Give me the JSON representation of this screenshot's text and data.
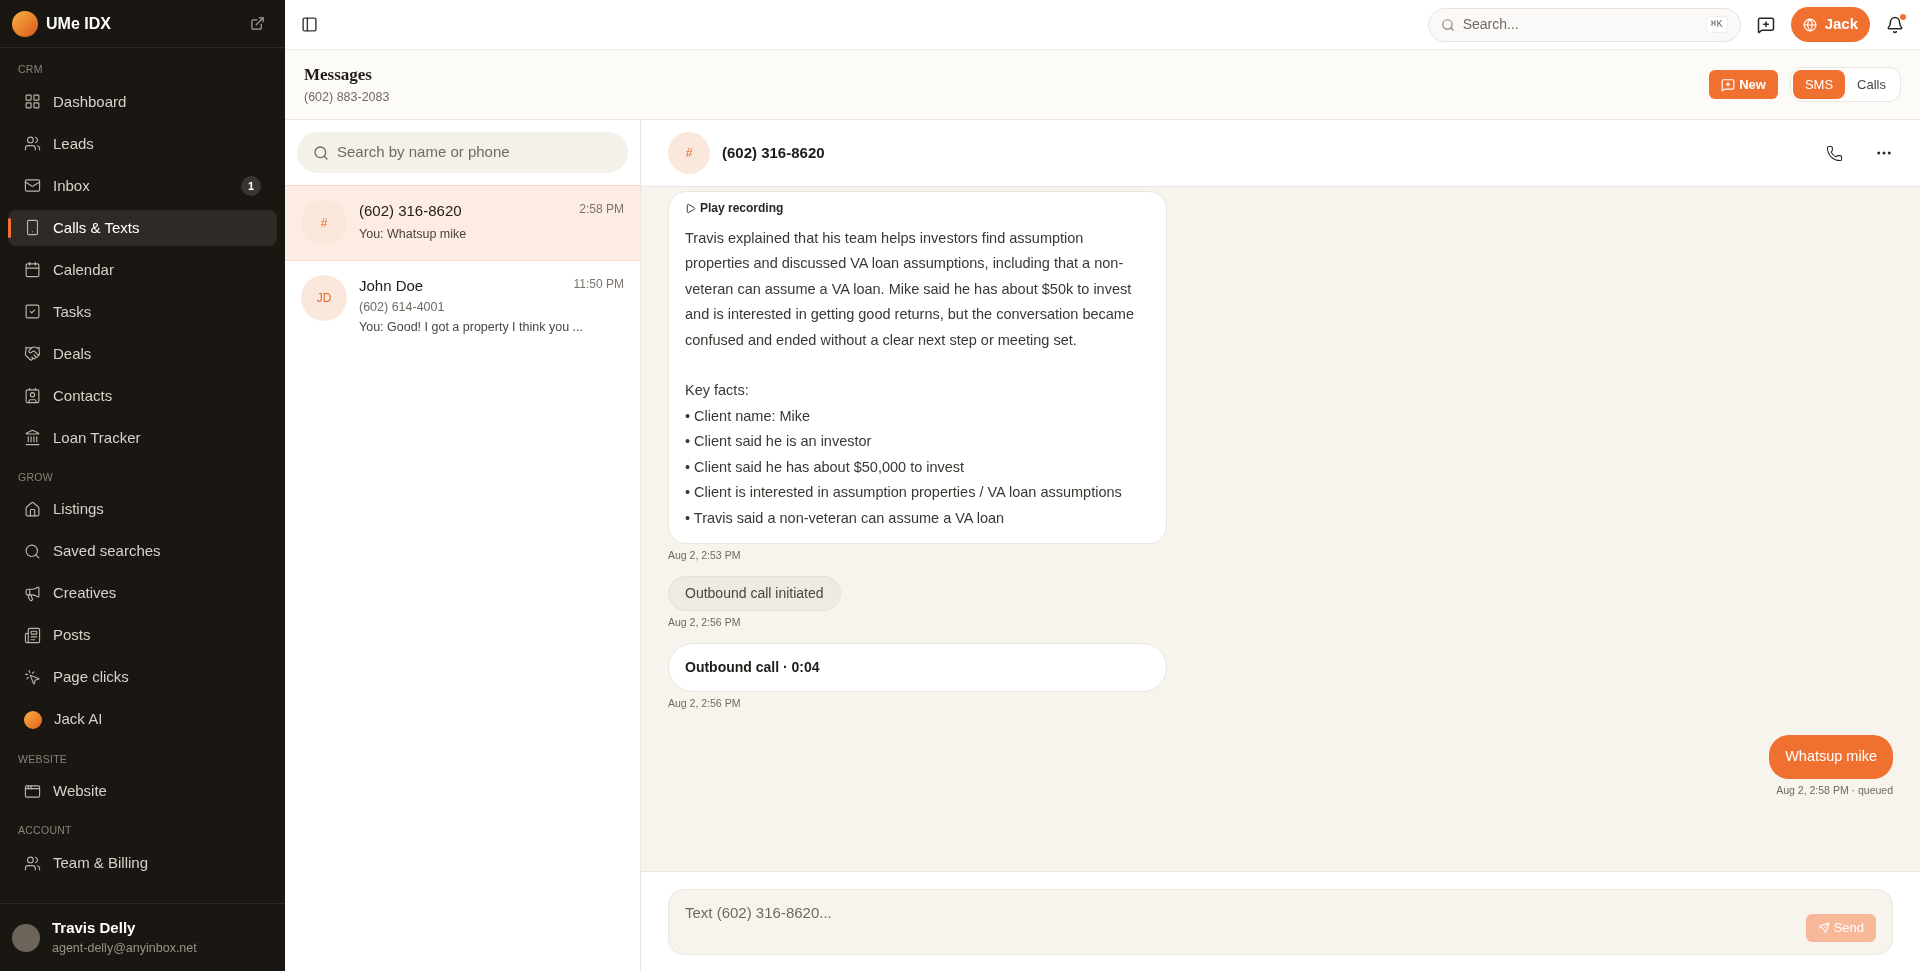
{
  "brand": {
    "name": "UMe IDX"
  },
  "sidebar": {
    "sections": [
      {
        "title": "CRM",
        "items": [
          {
            "label": "Dashboard",
            "kind": "nav",
            "selected": false
          },
          {
            "label": "Leads",
            "kind": "nav",
            "selected": false
          },
          {
            "label": "Inbox",
            "kind": "nav",
            "selected": false,
            "badge": "1"
          },
          {
            "label": "Calls & Texts",
            "kind": "nav",
            "selected": true
          },
          {
            "label": "Calendar",
            "kind": "nav",
            "selected": false
          },
          {
            "label": "Tasks",
            "kind": "nav",
            "selected": false
          },
          {
            "label": "Deals",
            "kind": "nav",
            "selected": false
          },
          {
            "label": "Contacts",
            "kind": "nav",
            "selected": false
          },
          {
            "label": "Loan Tracker",
            "kind": "nav",
            "selected": false
          }
        ]
      },
      {
        "title": "GROW",
        "items": [
          {
            "label": "Listings",
            "kind": "nav",
            "selected": false
          },
          {
            "label": "Saved searches",
            "kind": "nav",
            "selected": false
          },
          {
            "label": "Creatives",
            "kind": "nav",
            "selected": false
          },
          {
            "label": "Posts",
            "kind": "nav",
            "selected": false
          },
          {
            "label": "Page clicks",
            "kind": "nav",
            "selected": false
          },
          {
            "label": "Jack AI",
            "kind": "ai",
            "selected": false
          }
        ]
      },
      {
        "title": "WEBSITE",
        "items": [
          {
            "label": "Website",
            "kind": "nav",
            "selected": false
          }
        ]
      },
      {
        "title": "ACCOUNT",
        "items": [
          {
            "label": "Team & Billing",
            "kind": "nav",
            "selected": false
          }
        ]
      }
    ],
    "user": {
      "name": "Travis Delly",
      "email": "agent-delly@anyinbox.net"
    }
  },
  "topbar": {
    "search": {
      "placeholder": "Search...",
      "shortcut": "⌘K"
    },
    "agent_button": "Jack",
    "notification": true
  },
  "header": {
    "title": "Messages",
    "phone": "(602) 883-2083",
    "new_button": "New",
    "tabs": [
      {
        "label": "SMS",
        "selected": true
      },
      {
        "label": "Calls",
        "selected": false
      }
    ]
  },
  "conversations": {
    "search": {
      "placeholder": "Search by name or phone"
    },
    "items": [
      {
        "avatar": "#",
        "name": "(602) 316-8620",
        "time": "2:58 PM",
        "preview": "You: Whatsup mike",
        "selected": true
      },
      {
        "avatar": "JD",
        "name": "John Doe",
        "phone": "(602) 614-4001",
        "time": "11:50 PM",
        "preview": "You: Good! I got a property I think you ...",
        "selected": false
      }
    ]
  },
  "chat": {
    "avatar": "#",
    "title": "(602) 316-8620",
    "messages": [
      {
        "kind": "summary",
        "recording": "Play recording",
        "text": "Travis explained that his team helps investors find assumption properties and discussed VA loan assumptions, including that a non-veteran can assume a VA loan. Mike said he has about $50k to invest and is interested in getting good returns, but the conversation became confused and ended without a clear next step or meeting set.",
        "facts_title": "Key facts:",
        "facts": [
          "• Client name: Mike",
          "• Client said he is an investor",
          "• Client said he has about $50,000 to invest",
          "• Client is interested in assumption properties / VA loan assumptions",
          "• Travis said a non-veteran can assume a VA loan"
        ],
        "meta": "Aug 2, 2:53 PM"
      },
      {
        "kind": "event",
        "text": "Outbound call initiated",
        "meta": "Aug 2, 2:56 PM"
      },
      {
        "kind": "call",
        "text": "Outbound call · 0:04",
        "meta": "Aug 2, 2:56 PM"
      },
      {
        "kind": "outgoing",
        "text": "Whatsup mike",
        "meta": "Aug 2, 2:58 PM · queued"
      }
    ],
    "composer": {
      "placeholder": "Text (602) 316-8620...",
      "send": "Send",
      "disabled": true
    }
  }
}
